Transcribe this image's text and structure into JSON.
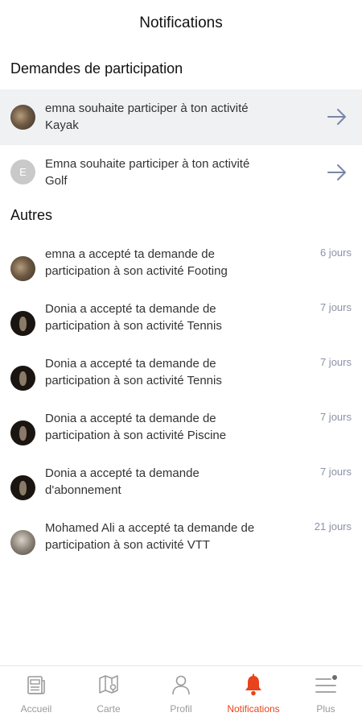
{
  "header": {
    "title": "Notifications"
  },
  "sections": {
    "requests_title": "Demandes de participation",
    "others_title": "Autres"
  },
  "requests": [
    {
      "avatar": "photo",
      "line1": "emna souhaite participer à ton activité",
      "line2": "Kayak"
    },
    {
      "avatar": "E",
      "line1": "Emna souhaite participer à ton activité",
      "line2": "Golf"
    }
  ],
  "others": [
    {
      "line1": "emna a accepté ta demande de",
      "line2": "participation à son activité Footing",
      "time": "6 jours"
    },
    {
      "line1": "Donia a accepté ta demande de",
      "line2": "participation à son activité Tennis",
      "time": "7 jours"
    },
    {
      "line1": "Donia a accepté ta demande de",
      "line2": "participation à son activité Tennis",
      "time": "7 jours"
    },
    {
      "line1": "Donia a accepté ta demande de",
      "line2": "participation à son activité Piscine",
      "time": "7 jours"
    },
    {
      "line1": "Donia a accepté ta demande",
      "line2": "d'abonnement",
      "time": "7 jours"
    },
    {
      "line1": "Mohamed Ali a accepté ta demande de",
      "line2": "participation à son activité VTT",
      "time": "21 jours"
    }
  ],
  "nav": [
    {
      "label": "Accueil",
      "icon": "newspaper-icon"
    },
    {
      "label": "Carte",
      "icon": "map-icon"
    },
    {
      "label": "Profil",
      "icon": "user-icon"
    },
    {
      "label": "Notifications",
      "icon": "bell-icon",
      "active": true
    },
    {
      "label": "Plus",
      "icon": "menu-icon"
    }
  ],
  "colors": {
    "accent": "#e8431a",
    "arrow": "#7a86a8",
    "inactive": "#9a9a9a"
  }
}
